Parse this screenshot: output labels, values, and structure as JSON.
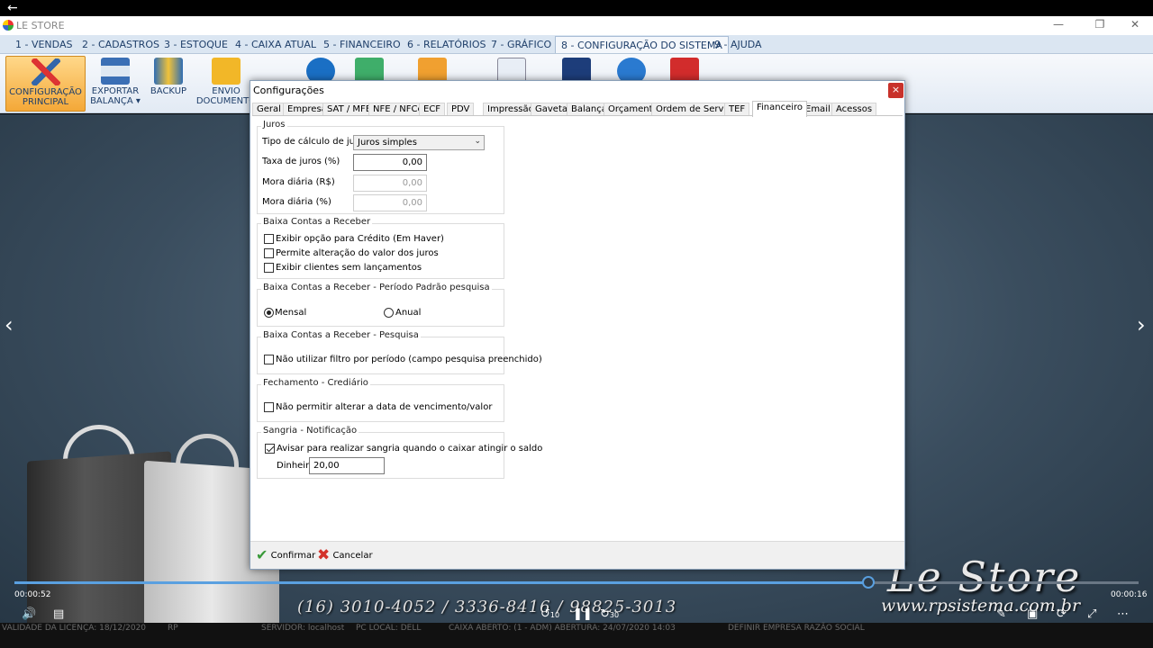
{
  "window": {
    "title": "LE STORE"
  },
  "menu": [
    {
      "label": "1 - VENDAS"
    },
    {
      "label": "2 - CADASTROS"
    },
    {
      "label": "3 - ESTOQUE"
    },
    {
      "label": "4 - CAIXA ATUAL"
    },
    {
      "label": "5 - FINANCEIRO"
    },
    {
      "label": "6 - RELATÓRIOS"
    },
    {
      "label": "7 - GRÁFICO"
    },
    {
      "label": "8 - CONFIGURAÇÃO DO SISTEMA"
    },
    {
      "label": "9 - AJUDA"
    }
  ],
  "ribbon": {
    "config": {
      "line1": "CONFIGURAÇÃO",
      "line2": "PRINCIPAL"
    },
    "exportar": {
      "line1": "EXPORTAR",
      "line2": "BALANÇA ▾"
    },
    "backup": {
      "line1": "BACKUP"
    },
    "envio": {
      "line1": "ENVIO",
      "line2": "DOCUMENTO"
    }
  },
  "dialog": {
    "title": "Configurações",
    "close": "×",
    "tabs": [
      "Geral",
      "Empresa",
      "SAT / MFE",
      "NFE / NFCe",
      "ECF",
      "PDV",
      "Impressão",
      "Gaveta",
      "Balança",
      "Orçamento",
      "Ordem de Serviço",
      "TEF",
      "Financeiro",
      "Email",
      "Acessos"
    ],
    "juros": {
      "title": "Juros",
      "tipo_label": "Tipo de cálculo de juros",
      "tipo_value": "Juros simples",
      "taxa_label": "Taxa de juros (%)",
      "taxa_value": "0,00",
      "mora_rs_label": "Mora diária (R$)",
      "mora_rs_value": "0,00",
      "mora_pct_label": "Mora diária (%)",
      "mora_pct_value": "0,00"
    },
    "baixa": {
      "title": "Baixa Contas a Receber",
      "opt1": "Exibir opção para Crédito (Em Haver)",
      "opt2": "Permite alteração do valor dos juros",
      "opt3": "Exibir clientes sem lançamentos"
    },
    "periodo": {
      "title": "Baixa Contas a Receber - Período Padrão pesquisa",
      "mensal": "Mensal",
      "anual": "Anual"
    },
    "pesquisa": {
      "title": "Baixa Contas a Receber - Pesquisa",
      "opt1": "Não utilizar filtro por período (campo pesquisa preenchido)"
    },
    "crediario": {
      "title": "Fechamento - Crediário",
      "opt1": "Não permitir alterar a data de vencimento/valor"
    },
    "sangria": {
      "title": "Sangria - Notificação",
      "opt1": "Avisar para realizar sangria quando o caixar atingir o saldo",
      "dinheiro_label": "Dinheiro",
      "dinheiro_value": "20,00"
    },
    "confirmar": "Confirmar",
    "cancelar": "Cancelar"
  },
  "brand": {
    "name": "Le Store",
    "site": "www.rpsistema.com.br",
    "phones": "(16) 3010-4052 / 3336-8416 / 98825-3013"
  },
  "video": {
    "elapsed": "00:00:52",
    "remaining": "00:00:16",
    "progress_fraction": 0.76,
    "rewind": "10",
    "forward": "30"
  },
  "statusbar": {
    "licenca": "VALIDADE DA LICENÇA: 18/12/2020",
    "rp": "RP",
    "servidor": "SERVIDOR: localhost",
    "pc": "PC LOCAL: DELL",
    "caixa": "CAIXA ABERTO: (1 - ADM) ABERTURA: 24/07/2020 14:03",
    "empresa": "DEFINIR EMPRESA RAZÃO SOCIAL"
  }
}
